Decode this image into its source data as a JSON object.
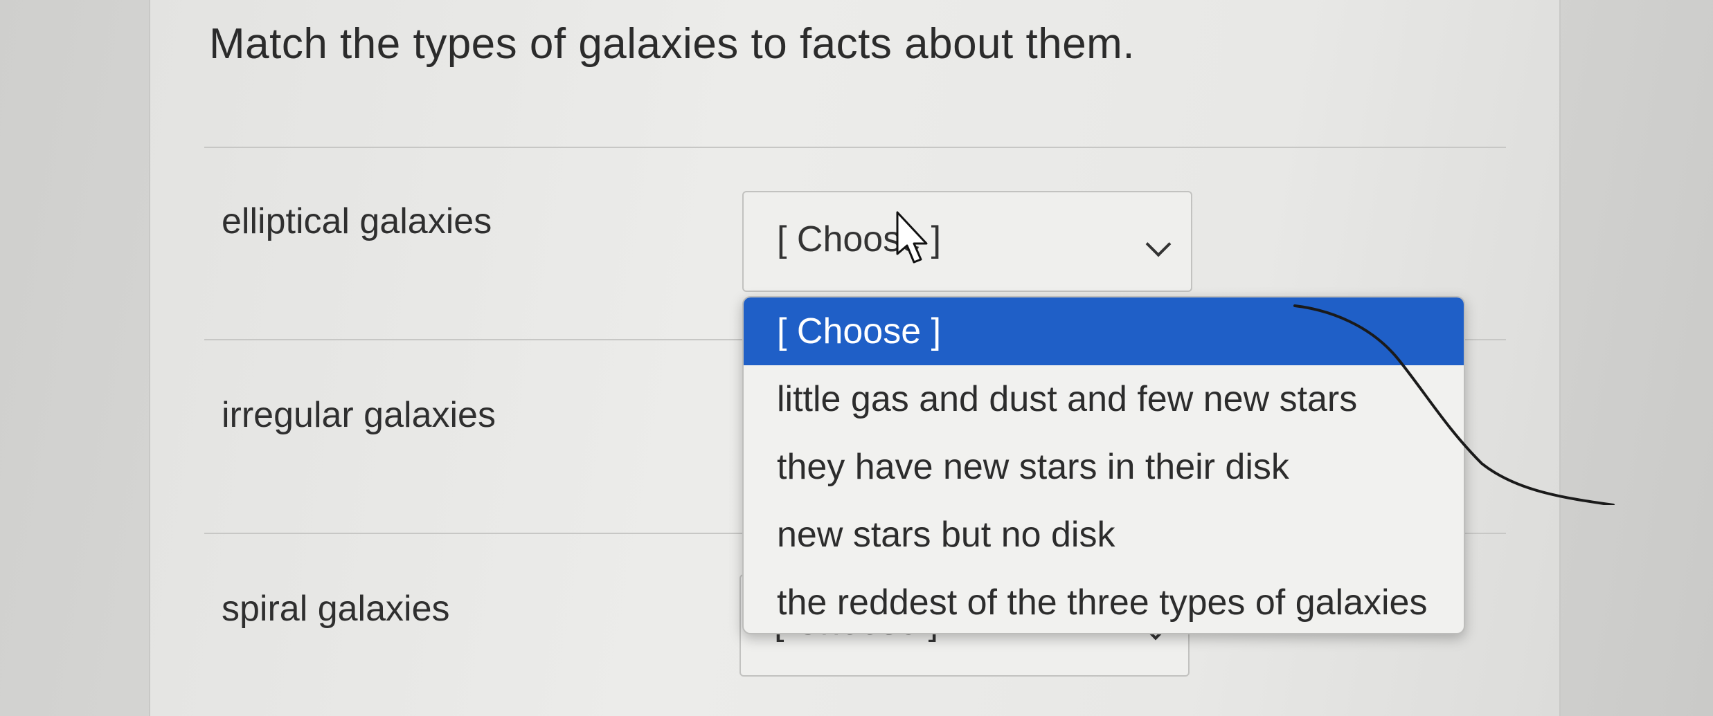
{
  "question": {
    "title": "Match the types of galaxies to facts about them."
  },
  "rows": [
    {
      "label": "elliptical galaxies",
      "select_value": "[ Choose ]"
    },
    {
      "label": "irregular galaxies",
      "select_value": ""
    },
    {
      "label": "spiral galaxies",
      "select_value": "[ Choose ]"
    }
  ],
  "dropdown": {
    "options": [
      "[ Choose ]",
      "little gas and dust and few new stars",
      "they have new stars in their disk",
      "new stars but no disk",
      "the reddest of the three types of galaxies"
    ],
    "highlighted_index": 0
  },
  "colors": {
    "highlight": "#1f5fc7"
  },
  "icons": {
    "cursor": "arrow-cursor-icon",
    "chevron": "chevron-down-icon"
  }
}
